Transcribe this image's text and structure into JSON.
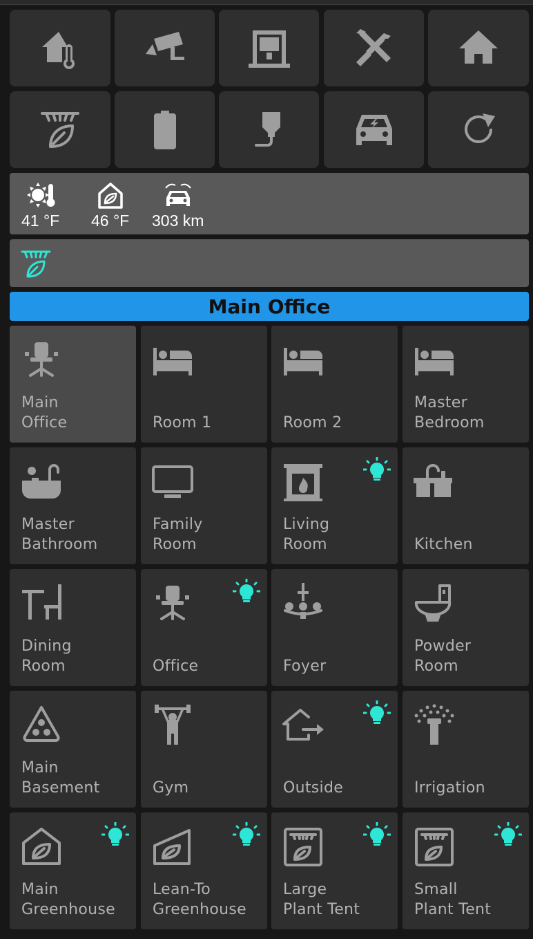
{
  "status": {
    "outdoor_temp": "41 °F",
    "greenhouse_temp": "46 °F",
    "car_range": "303 km"
  },
  "current_room": "Main Office",
  "rooms": [
    {
      "label": "Main\nOffice"
    },
    {
      "label": "Room 1"
    },
    {
      "label": "Room 2"
    },
    {
      "label": "Master\nBedroom"
    },
    {
      "label": "Master\nBathroom"
    },
    {
      "label": "Family\nRoom"
    },
    {
      "label": "Living\nRoom"
    },
    {
      "label": "Kitchen"
    },
    {
      "label": "Dining\nRoom"
    },
    {
      "label": "Office"
    },
    {
      "label": "Foyer"
    },
    {
      "label": "Powder\nRoom"
    },
    {
      "label": "Main\nBasement"
    },
    {
      "label": "Gym"
    },
    {
      "label": "Outside"
    },
    {
      "label": "Irrigation"
    },
    {
      "label": "Main\nGreenhouse"
    },
    {
      "label": "Lean-To\nGreenhouse"
    },
    {
      "label": "Large\nPlant Tent"
    },
    {
      "label": "Small\nPlant Tent"
    }
  ],
  "colors": {
    "accent_blue": "#2196e8",
    "light_on_cyan": "#2de6d6",
    "tile_bg": "#2f2f2f",
    "tile_active_bg": "#4a4a4a"
  }
}
